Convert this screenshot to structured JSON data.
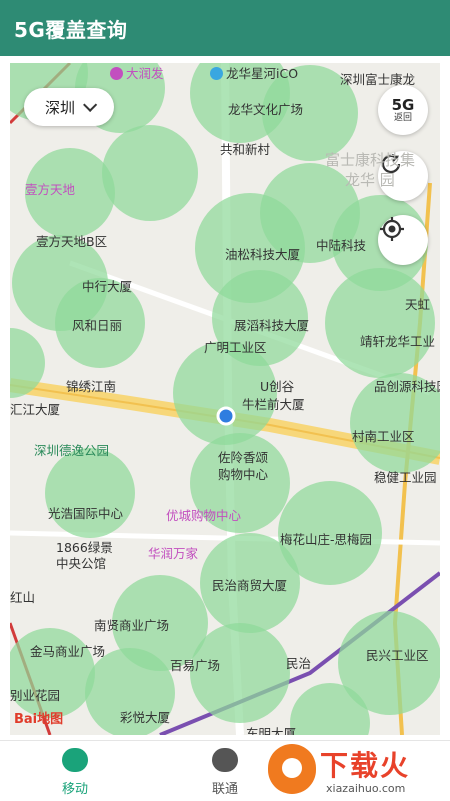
{
  "app": {
    "title": "5G覆盖查询"
  },
  "map": {
    "city": "深圳",
    "btn_5g": {
      "label": "5G",
      "sub": "返回"
    },
    "pois": [
      {
        "name": "poi-dahefa",
        "text": "大润发",
        "cls": "pink"
      },
      {
        "name": "poi-longhua-xinghe",
        "text": "龙华星河iCO",
        "cls": ""
      },
      {
        "name": "poi-fushikang",
        "text": "深圳富士康龙",
        "cls": ""
      },
      {
        "name": "poi-wenhua",
        "text": "龙华文化广场",
        "cls": ""
      },
      {
        "name": "poi-gongxin",
        "text": "共和新村",
        "cls": ""
      },
      {
        "name": "poi-fushikang-big",
        "text": "富士康科技集",
        "cls": "dim"
      },
      {
        "name": "poi-longhua-yuan",
        "text": "龙华    园",
        "cls": "dim"
      },
      {
        "name": "poi-yifang",
        "text": "壹方天地",
        "cls": "pink"
      },
      {
        "name": "poi-yifang-b",
        "text": "壹方天地B区",
        "cls": ""
      },
      {
        "name": "poi-yousong",
        "text": "油松科技大厦",
        "cls": ""
      },
      {
        "name": "poi-zhonglu",
        "text": "中陆科技",
        "cls": ""
      },
      {
        "name": "poi-zhonghang",
        "text": "中行大厦",
        "cls": ""
      },
      {
        "name": "poi-tianhong",
        "text": "天虹",
        "cls": ""
      },
      {
        "name": "poi-fengheri",
        "text": "风和日丽",
        "cls": ""
      },
      {
        "name": "poi-zhanzhi",
        "text": "展滔科技大厦",
        "cls": ""
      },
      {
        "name": "poi-jingxuan",
        "text": "靖轩龙华工业",
        "cls": ""
      },
      {
        "name": "poi-guangming",
        "text": "广明工业区",
        "cls": ""
      },
      {
        "name": "poi-jinxiu",
        "text": "锦绣江南",
        "cls": ""
      },
      {
        "name": "poi-uchuanggu",
        "text": "U创谷",
        "cls": ""
      },
      {
        "name": "poi-pinyuan",
        "text": "品创源科技园",
        "cls": ""
      },
      {
        "name": "poi-hujiang",
        "text": "汇江大厦",
        "cls": ""
      },
      {
        "name": "poi-niulanqian",
        "text": "牛栏前大厦",
        "cls": ""
      },
      {
        "name": "poi-cunnan",
        "text": "村南工业区",
        "cls": ""
      },
      {
        "name": "poi-deyi",
        "text": "深圳德逸公园",
        "cls": "green"
      },
      {
        "name": "poi-zuoling",
        "text": "佐阾香颂",
        "cls": ""
      },
      {
        "name": "poi-gouwu",
        "text": "购物中心",
        "cls": ""
      },
      {
        "name": "poi-wenjian",
        "text": "稳健工业园",
        "cls": ""
      },
      {
        "name": "poi-guanghao",
        "text": "光浩国际中心",
        "cls": ""
      },
      {
        "name": "poi-youcheng",
        "text": "优城购物中心",
        "cls": "pink"
      },
      {
        "name": "poi-meihua",
        "text": "梅花山庄-思梅园",
        "cls": ""
      },
      {
        "name": "poi-1866",
        "text": "1866绿景",
        "cls": ""
      },
      {
        "name": "poi-zhongyang",
        "text": "中央公馆",
        "cls": ""
      },
      {
        "name": "poi-huarun",
        "text": "华润万家",
        "cls": "pink"
      },
      {
        "name": "poi-minzhi",
        "text": "民治商贸大厦",
        "cls": ""
      },
      {
        "name": "poi-hongshan",
        "text": "红山",
        "cls": ""
      },
      {
        "name": "poi-nanxian",
        "text": "南贤商业广场",
        "cls": ""
      },
      {
        "name": "poi-jinma",
        "text": "金马商业广场",
        "cls": ""
      },
      {
        "name": "poi-baiyi",
        "text": "百易广场",
        "cls": ""
      },
      {
        "name": "poi-minzhi-station",
        "text": "民治",
        "cls": ""
      },
      {
        "name": "poi-minxing",
        "text": "民兴工业区",
        "cls": ""
      },
      {
        "name": "poi-yuehuayuan",
        "text": "别业花园",
        "cls": ""
      },
      {
        "name": "poi-caiyue",
        "text": "彩悦大厦",
        "cls": ""
      },
      {
        "name": "poi-dongming",
        "text": "东明大厦",
        "cls": ""
      }
    ],
    "logo_text": "Bai地图"
  },
  "tabs": [
    {
      "label": "移动",
      "active": true
    },
    {
      "label": "联通",
      "active": false
    }
  ],
  "watermark": {
    "title": "下载火",
    "url": "xiazaihuo.com"
  },
  "colors": {
    "appbar": "#2e8b74",
    "coverage": "#8fd99a",
    "accent": "#1aa37a"
  }
}
